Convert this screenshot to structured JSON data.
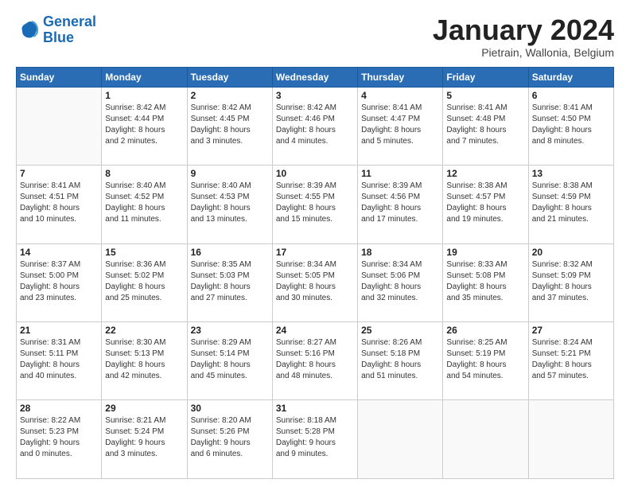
{
  "logo": {
    "line1": "General",
    "line2": "Blue"
  },
  "title": "January 2024",
  "location": "Pietrain, Wallonia, Belgium",
  "weekdays": [
    "Sunday",
    "Monday",
    "Tuesday",
    "Wednesday",
    "Thursday",
    "Friday",
    "Saturday"
  ],
  "weeks": [
    [
      {
        "day": "",
        "info": ""
      },
      {
        "day": "1",
        "info": "Sunrise: 8:42 AM\nSunset: 4:44 PM\nDaylight: 8 hours\nand 2 minutes."
      },
      {
        "day": "2",
        "info": "Sunrise: 8:42 AM\nSunset: 4:45 PM\nDaylight: 8 hours\nand 3 minutes."
      },
      {
        "day": "3",
        "info": "Sunrise: 8:42 AM\nSunset: 4:46 PM\nDaylight: 8 hours\nand 4 minutes."
      },
      {
        "day": "4",
        "info": "Sunrise: 8:41 AM\nSunset: 4:47 PM\nDaylight: 8 hours\nand 5 minutes."
      },
      {
        "day": "5",
        "info": "Sunrise: 8:41 AM\nSunset: 4:48 PM\nDaylight: 8 hours\nand 7 minutes."
      },
      {
        "day": "6",
        "info": "Sunrise: 8:41 AM\nSunset: 4:50 PM\nDaylight: 8 hours\nand 8 minutes."
      }
    ],
    [
      {
        "day": "7",
        "info": "Sunrise: 8:41 AM\nSunset: 4:51 PM\nDaylight: 8 hours\nand 10 minutes."
      },
      {
        "day": "8",
        "info": "Sunrise: 8:40 AM\nSunset: 4:52 PM\nDaylight: 8 hours\nand 11 minutes."
      },
      {
        "day": "9",
        "info": "Sunrise: 8:40 AM\nSunset: 4:53 PM\nDaylight: 8 hours\nand 13 minutes."
      },
      {
        "day": "10",
        "info": "Sunrise: 8:39 AM\nSunset: 4:55 PM\nDaylight: 8 hours\nand 15 minutes."
      },
      {
        "day": "11",
        "info": "Sunrise: 8:39 AM\nSunset: 4:56 PM\nDaylight: 8 hours\nand 17 minutes."
      },
      {
        "day": "12",
        "info": "Sunrise: 8:38 AM\nSunset: 4:57 PM\nDaylight: 8 hours\nand 19 minutes."
      },
      {
        "day": "13",
        "info": "Sunrise: 8:38 AM\nSunset: 4:59 PM\nDaylight: 8 hours\nand 21 minutes."
      }
    ],
    [
      {
        "day": "14",
        "info": "Sunrise: 8:37 AM\nSunset: 5:00 PM\nDaylight: 8 hours\nand 23 minutes."
      },
      {
        "day": "15",
        "info": "Sunrise: 8:36 AM\nSunset: 5:02 PM\nDaylight: 8 hours\nand 25 minutes."
      },
      {
        "day": "16",
        "info": "Sunrise: 8:35 AM\nSunset: 5:03 PM\nDaylight: 8 hours\nand 27 minutes."
      },
      {
        "day": "17",
        "info": "Sunrise: 8:34 AM\nSunset: 5:05 PM\nDaylight: 8 hours\nand 30 minutes."
      },
      {
        "day": "18",
        "info": "Sunrise: 8:34 AM\nSunset: 5:06 PM\nDaylight: 8 hours\nand 32 minutes."
      },
      {
        "day": "19",
        "info": "Sunrise: 8:33 AM\nSunset: 5:08 PM\nDaylight: 8 hours\nand 35 minutes."
      },
      {
        "day": "20",
        "info": "Sunrise: 8:32 AM\nSunset: 5:09 PM\nDaylight: 8 hours\nand 37 minutes."
      }
    ],
    [
      {
        "day": "21",
        "info": "Sunrise: 8:31 AM\nSunset: 5:11 PM\nDaylight: 8 hours\nand 40 minutes."
      },
      {
        "day": "22",
        "info": "Sunrise: 8:30 AM\nSunset: 5:13 PM\nDaylight: 8 hours\nand 42 minutes."
      },
      {
        "day": "23",
        "info": "Sunrise: 8:29 AM\nSunset: 5:14 PM\nDaylight: 8 hours\nand 45 minutes."
      },
      {
        "day": "24",
        "info": "Sunrise: 8:27 AM\nSunset: 5:16 PM\nDaylight: 8 hours\nand 48 minutes."
      },
      {
        "day": "25",
        "info": "Sunrise: 8:26 AM\nSunset: 5:18 PM\nDaylight: 8 hours\nand 51 minutes."
      },
      {
        "day": "26",
        "info": "Sunrise: 8:25 AM\nSunset: 5:19 PM\nDaylight: 8 hours\nand 54 minutes."
      },
      {
        "day": "27",
        "info": "Sunrise: 8:24 AM\nSunset: 5:21 PM\nDaylight: 8 hours\nand 57 minutes."
      }
    ],
    [
      {
        "day": "28",
        "info": "Sunrise: 8:22 AM\nSunset: 5:23 PM\nDaylight: 9 hours\nand 0 minutes."
      },
      {
        "day": "29",
        "info": "Sunrise: 8:21 AM\nSunset: 5:24 PM\nDaylight: 9 hours\nand 3 minutes."
      },
      {
        "day": "30",
        "info": "Sunrise: 8:20 AM\nSunset: 5:26 PM\nDaylight: 9 hours\nand 6 minutes."
      },
      {
        "day": "31",
        "info": "Sunrise: 8:18 AM\nSunset: 5:28 PM\nDaylight: 9 hours\nand 9 minutes."
      },
      {
        "day": "",
        "info": ""
      },
      {
        "day": "",
        "info": ""
      },
      {
        "day": "",
        "info": ""
      }
    ]
  ]
}
